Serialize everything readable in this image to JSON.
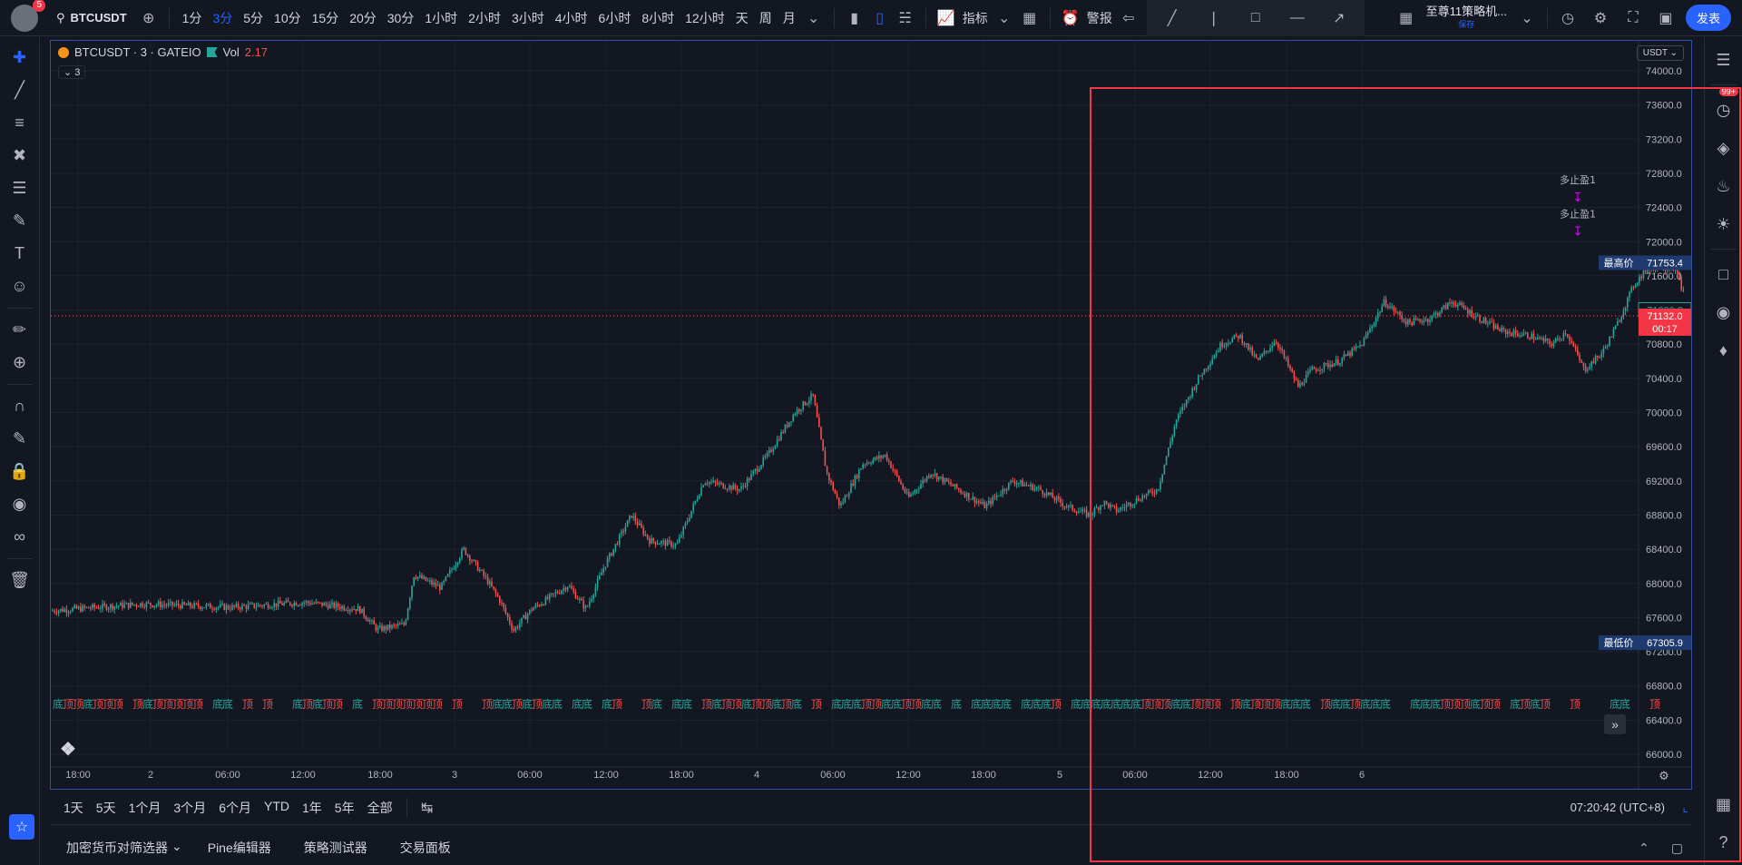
{
  "header": {
    "badge_count": "5",
    "symbol": "BTCUSDT",
    "timeframes": [
      "1分",
      "3分",
      "5分",
      "10分",
      "15分",
      "20分",
      "30分",
      "1小时",
      "2小时",
      "3小时",
      "4小时",
      "6小时",
      "8小时",
      "12小时",
      "天",
      "周",
      "月"
    ],
    "active_timeframe": "3分",
    "indicators_label": "指标",
    "alert_label": "警报",
    "strategy_name": "至尊11策略机...",
    "strategy_saved": "保存",
    "publish_label": "发表"
  },
  "chart": {
    "title": "BTCUSDT · 3 · GATEIO",
    "vol_label": "Vol",
    "vol_value": "2.17",
    "legend_toggle": "3",
    "currency": "USDT",
    "price_ticks": [
      "74000.0",
      "73600.0",
      "73200.0",
      "72800.0",
      "72400.0",
      "72000.0",
      "71600.0",
      "71200.0",
      "70800.0",
      "70400.0",
      "70000.0",
      "69600.0",
      "69200.0",
      "68800.0",
      "68400.0",
      "68000.0",
      "67600.0",
      "67200.0",
      "66800.0",
      "66400.0",
      "66000.0"
    ],
    "time_ticks": [
      "18:00",
      "2",
      "06:00",
      "12:00",
      "18:00",
      "3",
      "06:00",
      "12:00",
      "18:00",
      "4",
      "06:00",
      "12:00",
      "18:00",
      "5",
      "06:00",
      "12:00",
      "18:00",
      "6"
    ],
    "high_label": "最高价",
    "high_value": "71753.4",
    "low_label": "最低价",
    "low_value": "67305.9",
    "prev_value": "71200.8",
    "last_value": "71132.0",
    "countdown": "00:17",
    "signal_label_1": "多止盈1",
    "signal_label_2": "多止盈1",
    "top_marker": "顶",
    "bottom_marker": "底"
  },
  "bottom": {
    "ranges": [
      "1天",
      "5天",
      "1个月",
      "3个月",
      "6个月",
      "YTD",
      "1年",
      "5年",
      "全部"
    ],
    "clock": "07:20:42 (UTC+8)"
  },
  "panels": {
    "tabs": [
      "加密货币对筛选器",
      "Pine编辑器",
      "策略测试器",
      "交易面板"
    ]
  },
  "right": {
    "notif": "99+"
  },
  "colors": {
    "up": "#26a69a",
    "down": "#ef5350",
    "accent": "#2962ff",
    "background": "#131722"
  }
}
